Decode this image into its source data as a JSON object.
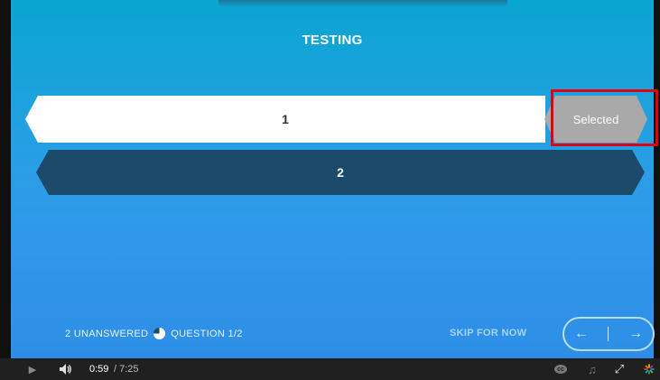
{
  "quiz": {
    "title": "TESTING",
    "options": [
      {
        "label": "1",
        "state": "selected"
      },
      {
        "label": "2",
        "state": "default"
      }
    ],
    "selected_tag": "Selected"
  },
  "footer": {
    "unanswered": "2 UNANSWERED",
    "question": "QUESTION 1/2",
    "skip_label": "SKIP FOR NOW",
    "prev_arrow": "←",
    "next_arrow": "→"
  },
  "player": {
    "current_time": "0:59",
    "total_time": "/ 7:25",
    "play_glyph": "▶",
    "volume_glyph": "🔈",
    "music_glyph": "♫",
    "cc_glyph": "cc",
    "fullscreen_glyph": "⤢",
    "icons": [
      "play-icon",
      "volume-icon",
      "cc-icon",
      "music-icon",
      "fullscreen-icon",
      "logo-icon"
    ]
  },
  "colors": {
    "option_selected_bg": "#ffffff",
    "option_default_bg": "#1c4a6a",
    "selected_tag_bg": "#a9a9a9",
    "highlight": "#e3000f"
  }
}
